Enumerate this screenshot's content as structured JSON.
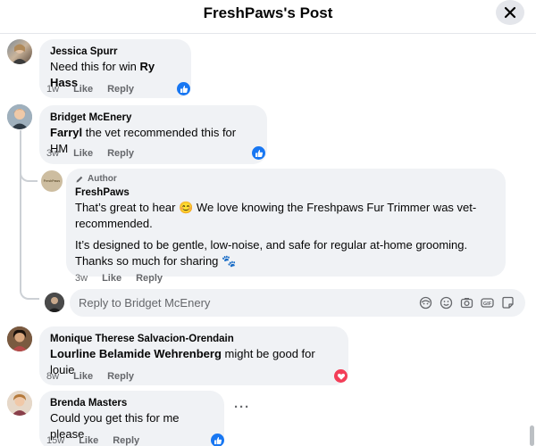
{
  "header": {
    "title": "FreshPaws's Post"
  },
  "comments": [
    {
      "name": "Jessica Spurr",
      "text_prefix": "Need this for win ",
      "mention": "Ry Hass",
      "text_suffix": "",
      "time": "1w",
      "like": "Like",
      "reply": "Reply",
      "reaction": "like"
    },
    {
      "name": "Bridget McEnery",
      "text_prefix": "",
      "mention": "Farryl",
      "text_suffix": " the vet recommended this for HM",
      "time": "3w",
      "like": "Like",
      "reply": "Reply",
      "reaction": "like"
    },
    {
      "name": "Monique Therese Salvacion-Orendain",
      "text_prefix": "",
      "mention": "Lourline Belamide Wehrenberg",
      "text_suffix": " might be good for louie",
      "time": "8w",
      "like": "Like",
      "reply": "Reply",
      "reaction": "love"
    },
    {
      "name": "Brenda Masters",
      "text_prefix": "Could you get this for me please",
      "mention": "",
      "text_suffix": "",
      "time": "15w",
      "like": "Like",
      "reply": "Reply",
      "reaction": "like"
    }
  ],
  "author_reply": {
    "badge": "Author",
    "name": "FreshPaws",
    "para1_a": "That’s great to hear ",
    "para1_emoji": "😊",
    "para1_b": " We love knowing the Freshpaws Fur Trimmer was vet-recommended.",
    "para2_a": "It’s designed to be gentle, low-noise, and safe for regular at-home grooming. Thanks so much for sharing ",
    "para2_emoji": "🐾",
    "time": "3w",
    "like": "Like",
    "reply": "Reply",
    "logo_text": "FreshPaws"
  },
  "reply_box": {
    "placeholder": "Reply to Bridget McEnery"
  },
  "ellipsis": "···",
  "colors": {
    "like": "#1877f2",
    "love": "#f33e58",
    "bubble": "#f0f2f5",
    "meta": "#65676b"
  }
}
